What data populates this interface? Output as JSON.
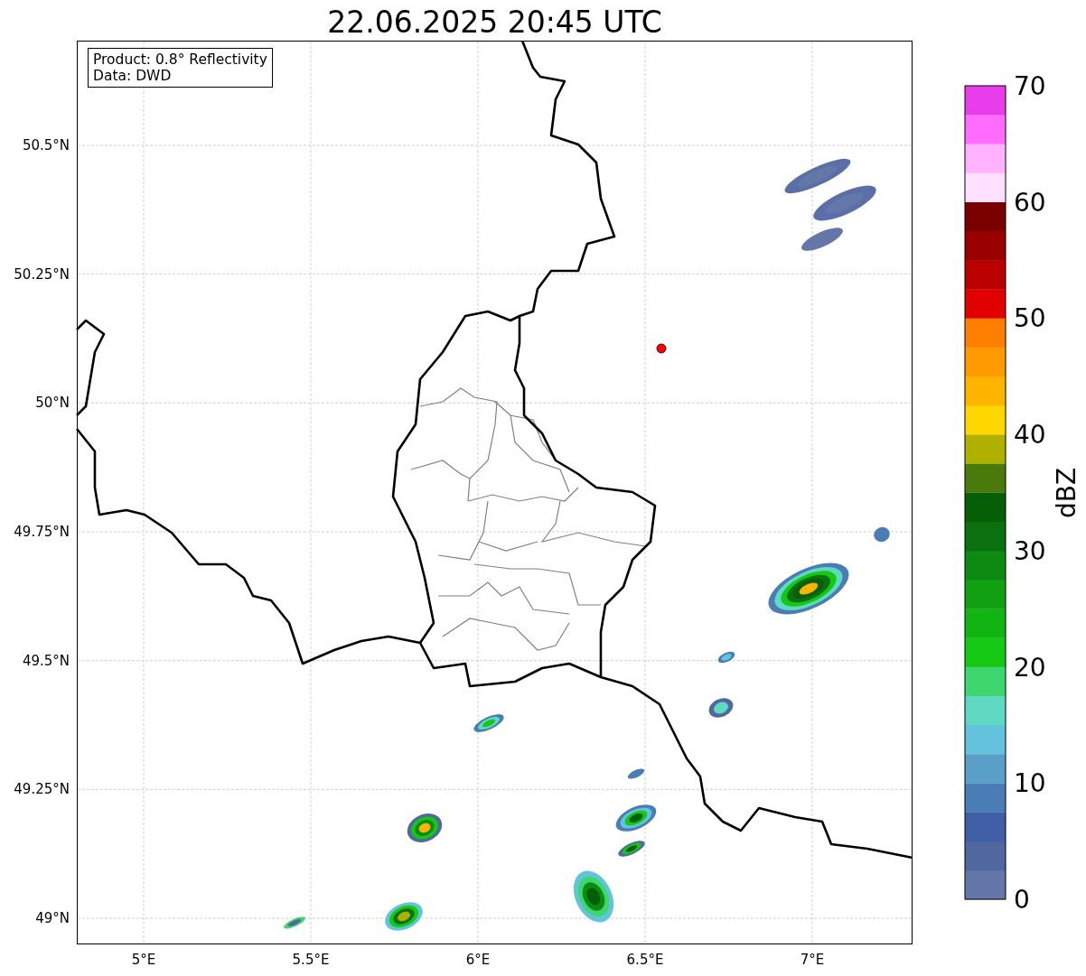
{
  "title": "22.06.2025 20:45 UTC",
  "info_box": {
    "lines": [
      "Product: 0.8° Reflectivity",
      "Data: DWD"
    ]
  },
  "map": {
    "y_ticks": [
      "50.5°N",
      "50.25°N",
      "50°N",
      "49.75°N",
      "49.5°N",
      "49.25°N",
      "49°N"
    ],
    "x_ticks": [
      "5°E",
      "5.5°E",
      "6°E",
      "6.5°E",
      "7°E"
    ]
  },
  "colorbar": {
    "label": "dBZ",
    "ticks": [
      "70",
      "60",
      "50",
      "40",
      "30",
      "20",
      "10",
      "0"
    ],
    "segments": [
      {
        "color": "#6477a8"
      },
      {
        "color": "#5167a0"
      },
      {
        "color": "#405ea6"
      },
      {
        "color": "#4a7db6"
      },
      {
        "color": "#5a9fc8"
      },
      {
        "color": "#63c3dc"
      },
      {
        "color": "#60d9c2"
      },
      {
        "color": "#3ed66e"
      },
      {
        "color": "#14c814"
      },
      {
        "color": "#12b414"
      },
      {
        "color": "#10a012"
      },
      {
        "color": "#0d8a12"
      },
      {
        "color": "#0a7010"
      },
      {
        "color": "#065f06"
      },
      {
        "color": "#4a7a0a"
      },
      {
        "color": "#b0b000"
      },
      {
        "color": "#ffd700"
      },
      {
        "color": "#ffb400"
      },
      {
        "color": "#ff9900"
      },
      {
        "color": "#ff7f00"
      },
      {
        "color": "#e00000"
      },
      {
        "color": "#bb0000"
      },
      {
        "color": "#9a0000"
      },
      {
        "color": "#7a0000"
      },
      {
        "color": "#ffe0ff"
      },
      {
        "color": "#ffb3ff"
      },
      {
        "color": "#ff6cff"
      },
      {
        "color": "#e93cea"
      }
    ]
  }
}
